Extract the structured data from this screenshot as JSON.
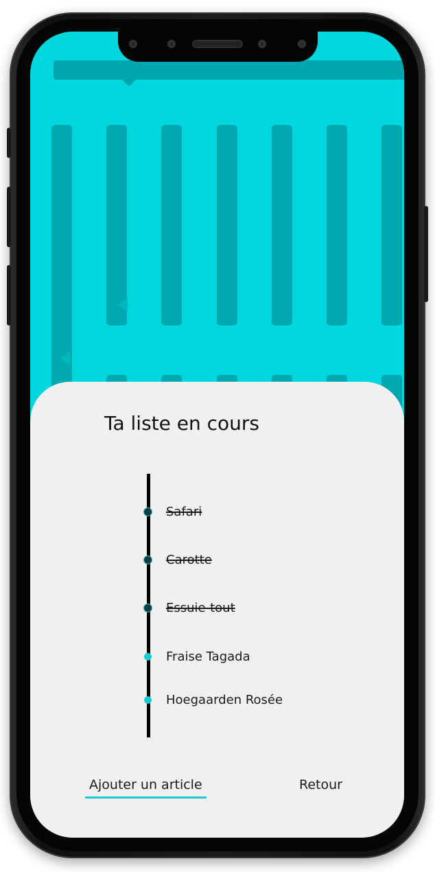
{
  "theme": {
    "accent": "#1ec8d0",
    "background": "#00d6de",
    "sheet": "#f0f0f0"
  },
  "sheet": {
    "title": "Ta liste en cours",
    "items": [
      {
        "label": "Safari",
        "done": true
      },
      {
        "label": "Carotte",
        "done": true
      },
      {
        "label": "Essuie-tout",
        "done": true
      },
      {
        "label": "Fraise Tagada",
        "done": false
      },
      {
        "label": "Hoegaarden Rosée",
        "done": false
      }
    ]
  },
  "actions": {
    "add_label": "Ajouter un article",
    "back_label": "Retour"
  }
}
